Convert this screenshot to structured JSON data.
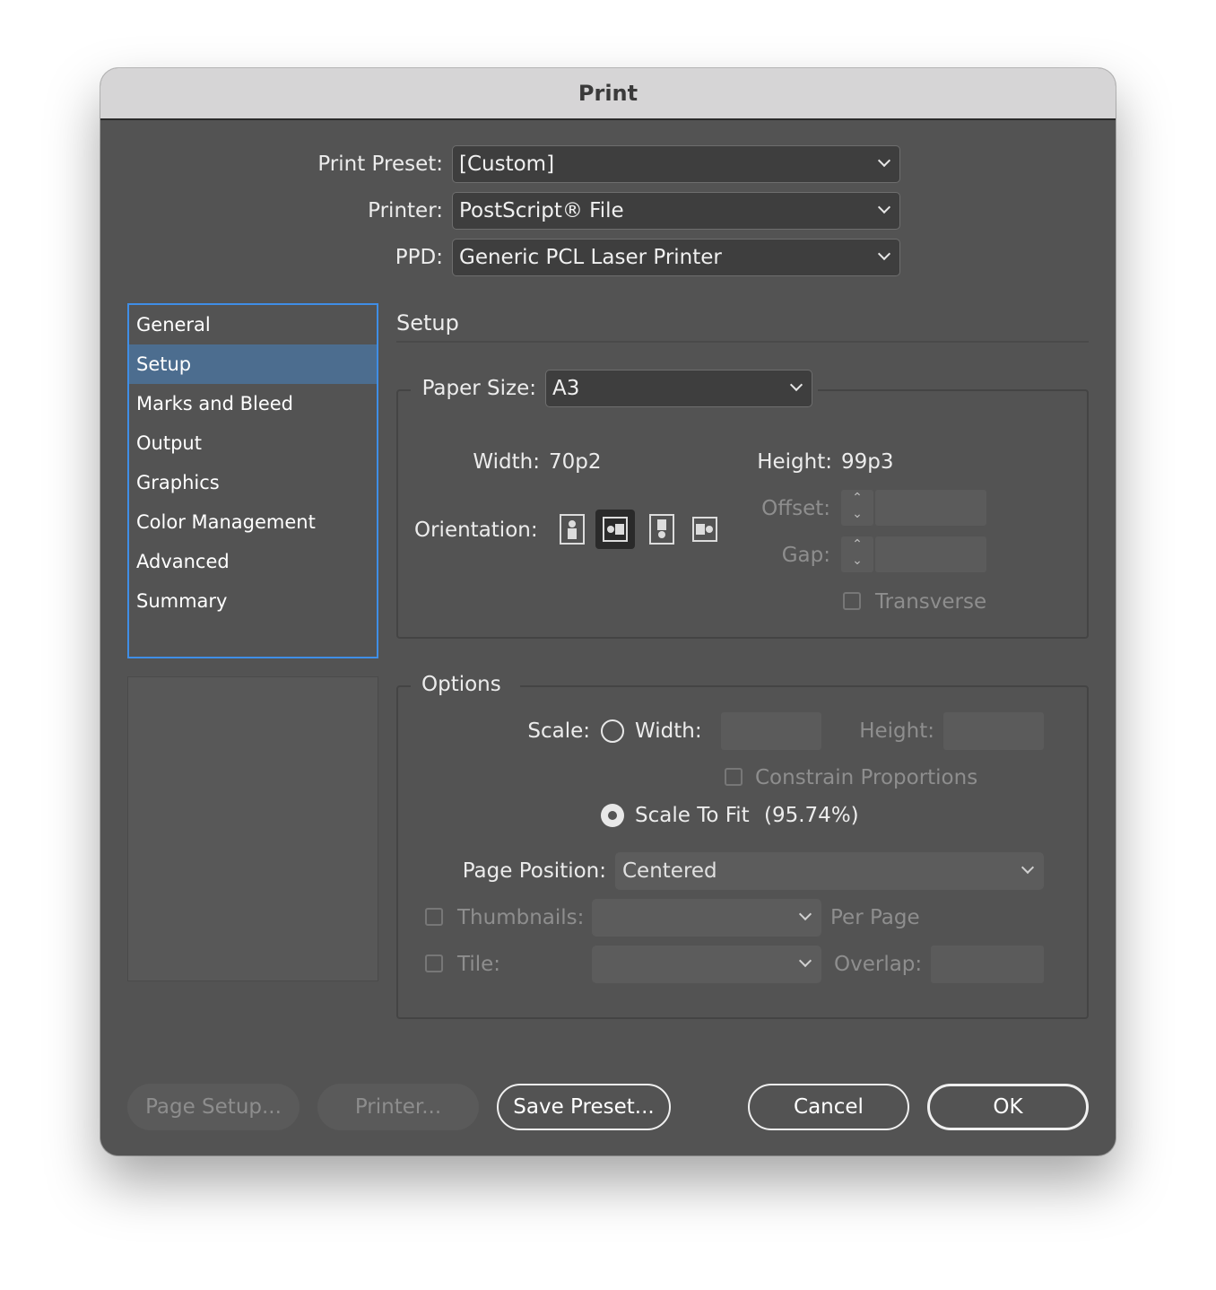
{
  "window": {
    "title": "Print"
  },
  "top": {
    "preset_label": "Print Preset:",
    "preset_value": "[Custom]",
    "printer_label": "Printer:",
    "printer_value": "PostScript® File",
    "ppd_label": "PPD:",
    "ppd_value": "Generic PCL Laser Printer"
  },
  "sidebar": {
    "items": [
      {
        "label": "General"
      },
      {
        "label": "Setup"
      },
      {
        "label": "Marks and Bleed"
      },
      {
        "label": "Output"
      },
      {
        "label": "Graphics"
      },
      {
        "label": "Color Management"
      },
      {
        "label": "Advanced"
      },
      {
        "label": "Summary"
      }
    ],
    "selected": "Setup"
  },
  "setup": {
    "heading": "Setup",
    "paper_size_label": "Paper Size:",
    "paper_size_value": "A3",
    "width_label": "Width:",
    "width_value": "70p2",
    "height_label": "Height:",
    "height_value": "99p3",
    "orientation_label": "Orientation:",
    "orientation_icons": [
      "portrait-icon",
      "landscape-icon",
      "reverse-portrait-icon",
      "reverse-landscape-icon"
    ],
    "orientation_selected": "landscape-icon",
    "offset_label": "Offset:",
    "gap_label": "Gap:",
    "transverse_label": "Transverse"
  },
  "options": {
    "heading": "Options",
    "scale_label": "Scale:",
    "width_label": "Width:",
    "height_label": "Height:",
    "constrain_label": "Constrain Proportions",
    "scale_to_fit_label": "Scale To Fit",
    "scale_to_fit_value": "(95.74%)",
    "page_position_label": "Page Position:",
    "page_position_value": "Centered",
    "thumbnails_label": "Thumbnails:",
    "per_page_label": "Per Page",
    "tile_label": "Tile:",
    "overlap_label": "Overlap:"
  },
  "buttons": {
    "page_setup": "Page Setup...",
    "printer": "Printer...",
    "save_preset": "Save Preset...",
    "cancel": "Cancel",
    "ok": "OK"
  },
  "colors": {
    "dialog_bg": "#535353",
    "selection": "#4c6d8f",
    "focus_ring": "#3f8ee6"
  }
}
